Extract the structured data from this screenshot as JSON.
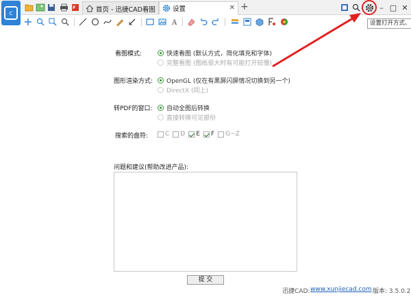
{
  "titlebar": {
    "tabs": [
      {
        "label": "首页 - 迅捷CAD看图",
        "icon": "home-icon"
      },
      {
        "label": "设置",
        "icon": "gear-icon"
      }
    ],
    "add_tab": "+",
    "window_buttons": {
      "minimize": "–",
      "maximize": "□",
      "close": "✕"
    },
    "tooltip": "设置打开方式、界"
  },
  "settings": {
    "view_mode": {
      "label": "看图模式:",
      "options": [
        {
          "text": "快速看图 (默认方式，简化填充和字体)",
          "selected": true,
          "enabled": true
        },
        {
          "text": "完整看图 (图纸很大时有可能打开较慢)",
          "selected": false,
          "enabled": false
        }
      ]
    },
    "render_mode": {
      "label": "图形渲染方式:",
      "options": [
        {
          "text": "OpenGL (仅在有黑屏闪屏情况切换到另一个)",
          "selected": true,
          "enabled": true
        },
        {
          "text": "DirectX  (同上)",
          "selected": false,
          "enabled": false
        }
      ]
    },
    "pdf_window": {
      "label": "转PDF的窗口:",
      "options": [
        {
          "text": "自动全图后转换",
          "selected": true,
          "enabled": true
        },
        {
          "text": "直接转换可见部份",
          "selected": false,
          "enabled": false
        }
      ]
    },
    "drives": {
      "label": "搜索的盘符:",
      "items": [
        {
          "text": "C",
          "checked": false
        },
        {
          "text": "D",
          "checked": false
        },
        {
          "text": "E",
          "checked": true
        },
        {
          "text": "F",
          "checked": true
        },
        {
          "text": "G~Z",
          "checked": false
        }
      ]
    },
    "feedback": {
      "label": "问题和建议(帮助改进产品):",
      "value": ""
    },
    "submit_label": "提  交"
  },
  "footer": {
    "brand": "迅捷CAD:",
    "url": "www.xunjiecad.com",
    "version": "版本: 3.5.0.2"
  },
  "colors": {
    "accent": "#2f82d6",
    "highlight": "#e02020",
    "radio_on": "#2e8b2e"
  }
}
